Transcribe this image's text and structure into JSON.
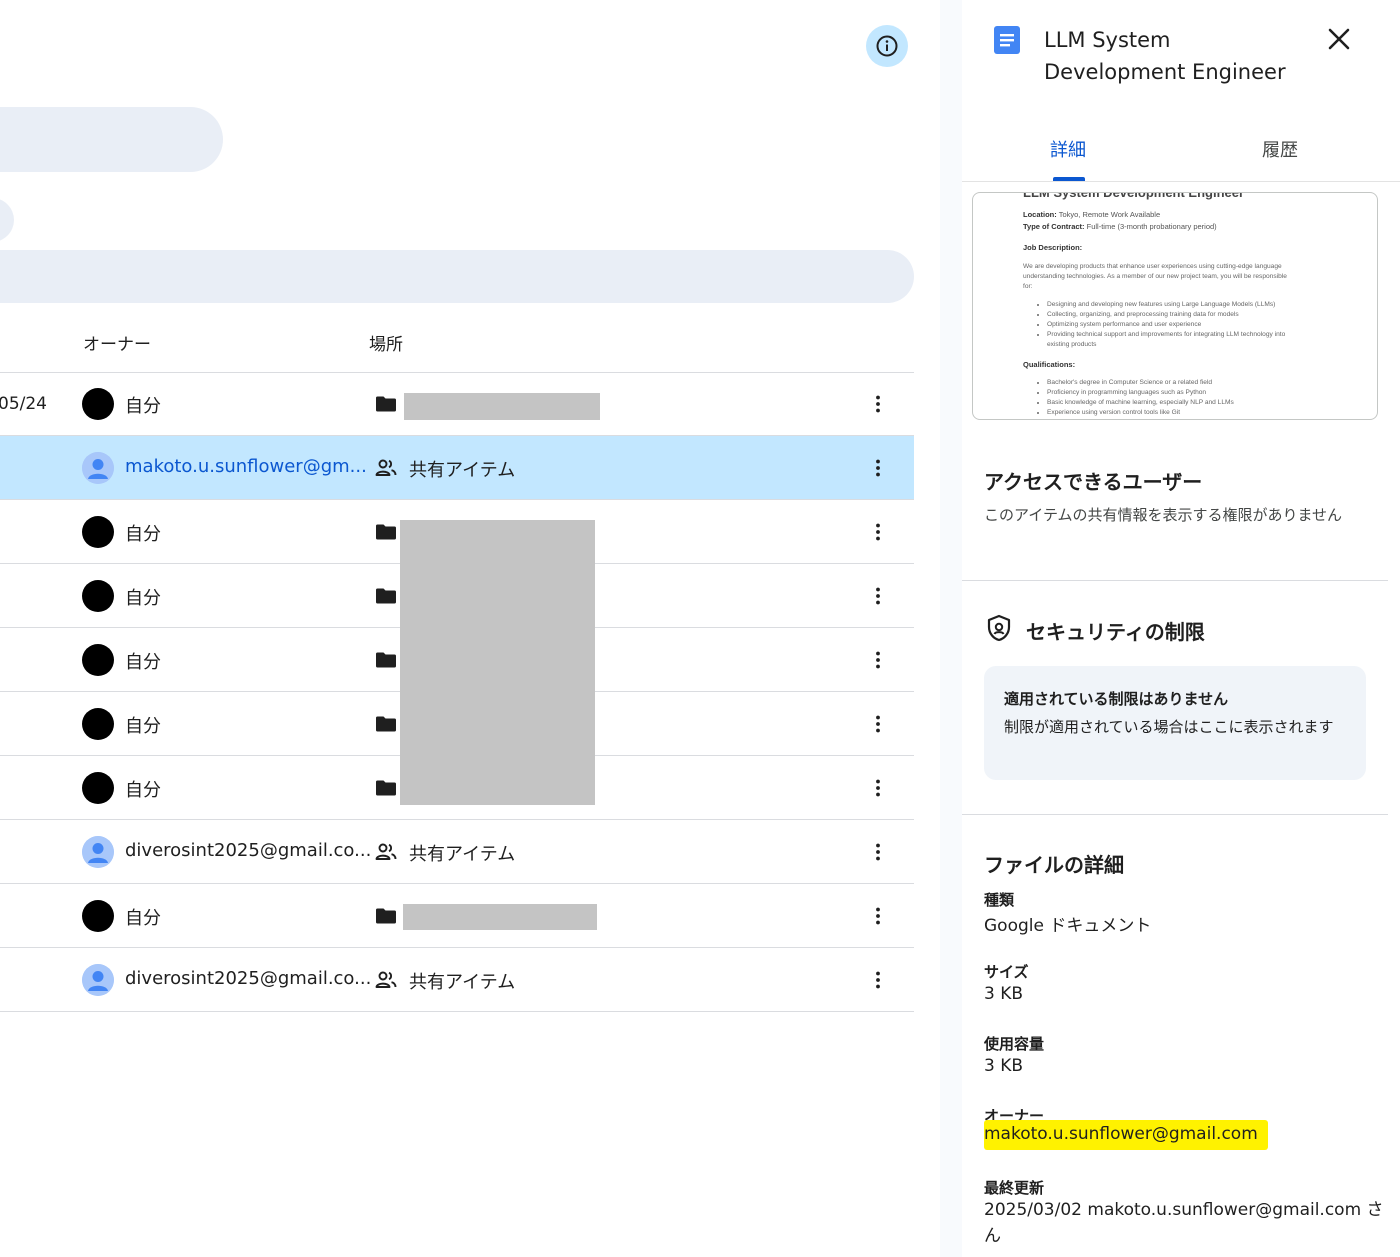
{
  "file_list": {
    "columns": {
      "owner": "オーナー",
      "location": "場所"
    },
    "rows": [
      {
        "date": "05/24",
        "owner": "自分",
        "owner_avatar": "black",
        "location": "",
        "location_icon": "folder-icon",
        "selected": false
      },
      {
        "date": "",
        "owner": "makoto.u.sunflower@gm...",
        "owner_avatar": "person",
        "location": "共有アイテム",
        "location_icon": "shared-users-icon",
        "selected": true
      },
      {
        "date": "",
        "owner": "自分",
        "owner_avatar": "black",
        "location": "",
        "location_icon": "folder-icon",
        "selected": false
      },
      {
        "date": "",
        "owner": "自分",
        "owner_avatar": "black",
        "location": "",
        "location_icon": "folder-icon",
        "selected": false
      },
      {
        "date": "",
        "owner": "自分",
        "owner_avatar": "black",
        "location": "",
        "location_icon": "folder-icon",
        "selected": false
      },
      {
        "date": "",
        "owner": "自分",
        "owner_avatar": "black",
        "location": "",
        "location_icon": "folder-icon",
        "selected": false
      },
      {
        "date": "",
        "owner": "自分",
        "owner_avatar": "black",
        "location": "",
        "location_icon": "folder-icon",
        "selected": false
      },
      {
        "date": "",
        "owner": "diverosint2025@gmail.co...",
        "owner_avatar": "person",
        "location": "共有アイテム",
        "location_icon": "shared-users-icon",
        "selected": false
      },
      {
        "date": "",
        "owner": "自分",
        "owner_avatar": "black",
        "location": "",
        "location_icon": "folder-icon",
        "selected": false
      },
      {
        "date": "",
        "owner": "diverosint2025@gmail.co...",
        "owner_avatar": "person",
        "location": "共有アイテム",
        "location_icon": "shared-users-icon",
        "selected": false
      }
    ]
  },
  "details": {
    "title": "LLM System Development Engineer",
    "tabs": [
      "詳細",
      "履歴"
    ],
    "preview": {
      "heading": "LLM System Development Engineer",
      "location_label": "Location:",
      "location_value": "Tokyo, Remote Work Available",
      "contract_label": "Type of Contract:",
      "contract_value": "Full-time (3-month probationary period)",
      "job_description_label": "Job Description:",
      "job_description_1": "We are developing products that enhance user experiences using cutting-edge language",
      "job_description_2": "understanding technologies. As a member of our new project team, you will be responsible",
      "job_description_3": "for:",
      "duties": [
        "Designing and developing new features using Large Language Models (LLMs)",
        "Collecting, organizing, and preprocessing training data for models",
        "Optimizing system performance and user experience",
        "Providing technical support and improvements for integrating LLM technology into",
        "existing products"
      ],
      "qualifications_label": "Qualifications:",
      "qualifications": [
        "Bachelor's degree in Computer Science or a related field",
        "Proficiency in programming languages such as Python",
        "Basic knowledge of machine learning, especially NLP and LLMs",
        "Experience using version control tools like Git"
      ]
    },
    "access": {
      "title": "アクセスできるユーザー",
      "text": "このアイテムの共有情報を表示する権限がありません"
    },
    "security": {
      "title": "セキュリティの制限",
      "box_title": "適用されている制限はありません",
      "box_text": "制限が適用されている場合はここに表示されます"
    },
    "file_details": {
      "title": "ファイルの詳細",
      "type_label": "種類",
      "type_value": "Google ドキュメント",
      "size_label": "サイズ",
      "size_value": "3 KB",
      "storage_label": "使用容量",
      "storage_value": "3 KB",
      "owner_label": "オーナー",
      "owner_value": "makoto.u.sunflower@gmail.com",
      "modified_label": "最終更新",
      "modified_value": "2025/03/02 makoto.u.sunflower@gmail.com さん"
    }
  },
  "colors": {
    "selected_row": "#c2e7ff",
    "accent": "#0b57d0",
    "highlight": "#fff200",
    "redaction": "#c4c4c4"
  }
}
